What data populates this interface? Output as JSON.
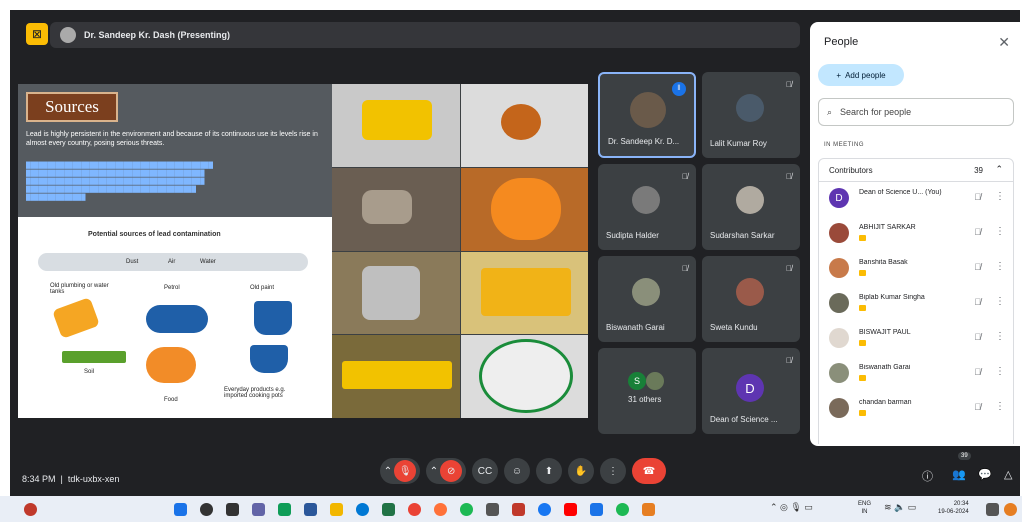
{
  "presenter_bar": {
    "text": "Dr. Sandeep Kr. Dash (Presenting)"
  },
  "slide": {
    "heading": "Sources",
    "body": "Lead is highly persistent in the environment and because of its continuous use its levels rise in almost every country, posing serious threats.",
    "diagram": {
      "title": "Potential sources of lead contamination",
      "labels": [
        "Dust",
        "Air",
        "Water",
        "Old plumbing or water tanks",
        "Petrol",
        "Old paint",
        "Soil",
        "Food",
        "Everyday products e.g. imported cooking pots"
      ]
    }
  },
  "tiles": [
    {
      "name": "Dr. Sandeep Kr. D..."
    },
    {
      "name": "Lalit Kumar Roy"
    },
    {
      "name": "Sudipta Halder"
    },
    {
      "name": "Sudarshan Sarkar"
    },
    {
      "name": "Biswanath Garai"
    },
    {
      "name": "Sweta Kundu"
    },
    {
      "name": "31 others"
    },
    {
      "name": "Dean of Science ..."
    }
  ],
  "tile_initials": {
    "others": "S",
    "dean": "D"
  },
  "panel": {
    "title": "People",
    "close": "✕",
    "add_people": "Add people",
    "search_placeholder": "Search for people",
    "in_meeting": "IN MEETING",
    "contributors_label": "Contributors",
    "contributors_count": "39",
    "participants": [
      {
        "name": "Dean of Science U... (You)",
        "initial": "D"
      },
      {
        "name": "ABHIJIT SARKAR",
        "initial": ""
      },
      {
        "name": "Banshita Basak",
        "initial": ""
      },
      {
        "name": "Biplab Kumar Singha",
        "initial": ""
      },
      {
        "name": "BISWAJIT PAUL",
        "initial": ""
      },
      {
        "name": "Biswanath Garai",
        "initial": ""
      },
      {
        "name": "chandan barman",
        "initial": ""
      }
    ]
  },
  "bottom": {
    "time": "8:34 PM",
    "meeting_code": "tdk-uxbx-xen",
    "people_badge": "39"
  },
  "taskbar": {
    "lang": "ENG",
    "lang2": "IN",
    "clock": "20:34",
    "date": "19-06-2024"
  }
}
